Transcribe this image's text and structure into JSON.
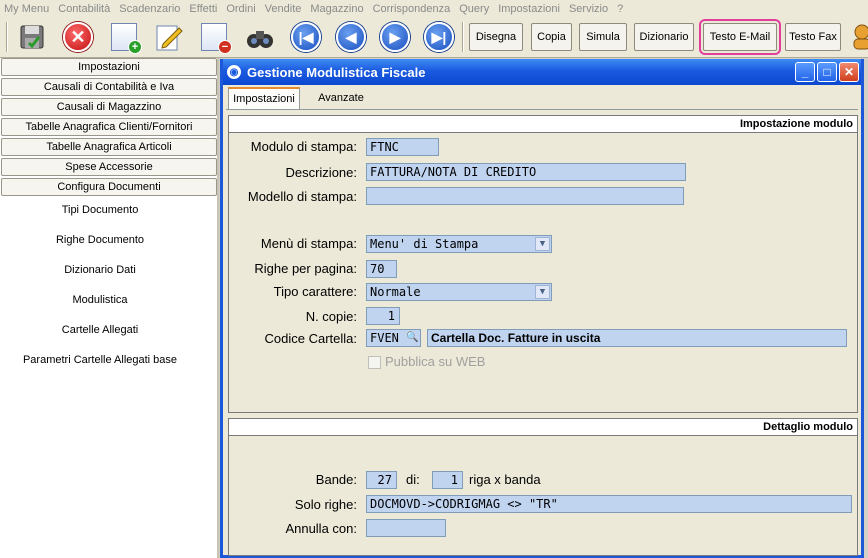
{
  "menubar": [
    "My Menu",
    "Contabilità",
    "Scadenzario",
    "Effetti",
    "Ordini",
    "Vendite",
    "Magazzino",
    "Corrispondenza",
    "Query",
    "Impostazioni",
    "Servizio",
    "?"
  ],
  "toolbar": {
    "buttons": [
      "Disegna",
      "Copia",
      "Simula",
      "Dizionario",
      "Testo E-Mail",
      "Testo Fax"
    ]
  },
  "left_panel": {
    "sections": [
      "Impostazioni",
      "Causali di Contabilità e Iva",
      "Causali di Magazzino",
      "Tabelle Anagrafica Clienti/Fornitori",
      "Tabelle Anagrafica Articoli",
      "Spese Accessorie",
      "Configura Documenti"
    ],
    "links": [
      "Tipi Documento",
      "Righe Documento",
      "Dizionario Dati",
      "Modulistica",
      "Cartelle Allegati",
      "Parametri Cartelle Allegati base"
    ]
  },
  "window": {
    "title": "Gestione Modulistica Fiscale",
    "tabs": [
      "Impostazioni",
      "Avanzate"
    ],
    "group1": {
      "header": "Impostazione modulo",
      "modulo_label": "Modulo di stampa:",
      "modulo_value": "FTNC",
      "descrizione_label": "Descrizione:",
      "descrizione_value": "FATTURA/NOTA DI CREDITO",
      "modello_label": "Modello di stampa:",
      "modello_value": "",
      "menu_label": "Menù di stampa:",
      "menu_value": "Menu' di Stampa",
      "righe_label": "Righe per pagina:",
      "righe_value": "70",
      "carattere_label": "Tipo carattere:",
      "carattere_value": "Normale",
      "copie_label": "N. copie:",
      "copie_value": "1",
      "cartella_label": "Codice Cartella:",
      "cartella_code": "FVEN",
      "cartella_desc": "Cartella Doc. Fatture in uscita",
      "web_label": "Pubblica su WEB"
    },
    "group2": {
      "header": "Dettaglio modulo",
      "bande_label": "Bande:",
      "bande_value": "27",
      "di_label": "di:",
      "di_value": "1",
      "riga_label": "riga x banda",
      "solo_label": "Solo righe:",
      "solo_value": "DOCMOVD->CODRIGMAG <> \"TR\"",
      "annulla_label": "Annulla con:",
      "annulla_value": ""
    }
  },
  "colors": {
    "titlebar": "#1a5ae0",
    "field_bg": "#c0d4f0",
    "highlight": "#e0409a"
  }
}
